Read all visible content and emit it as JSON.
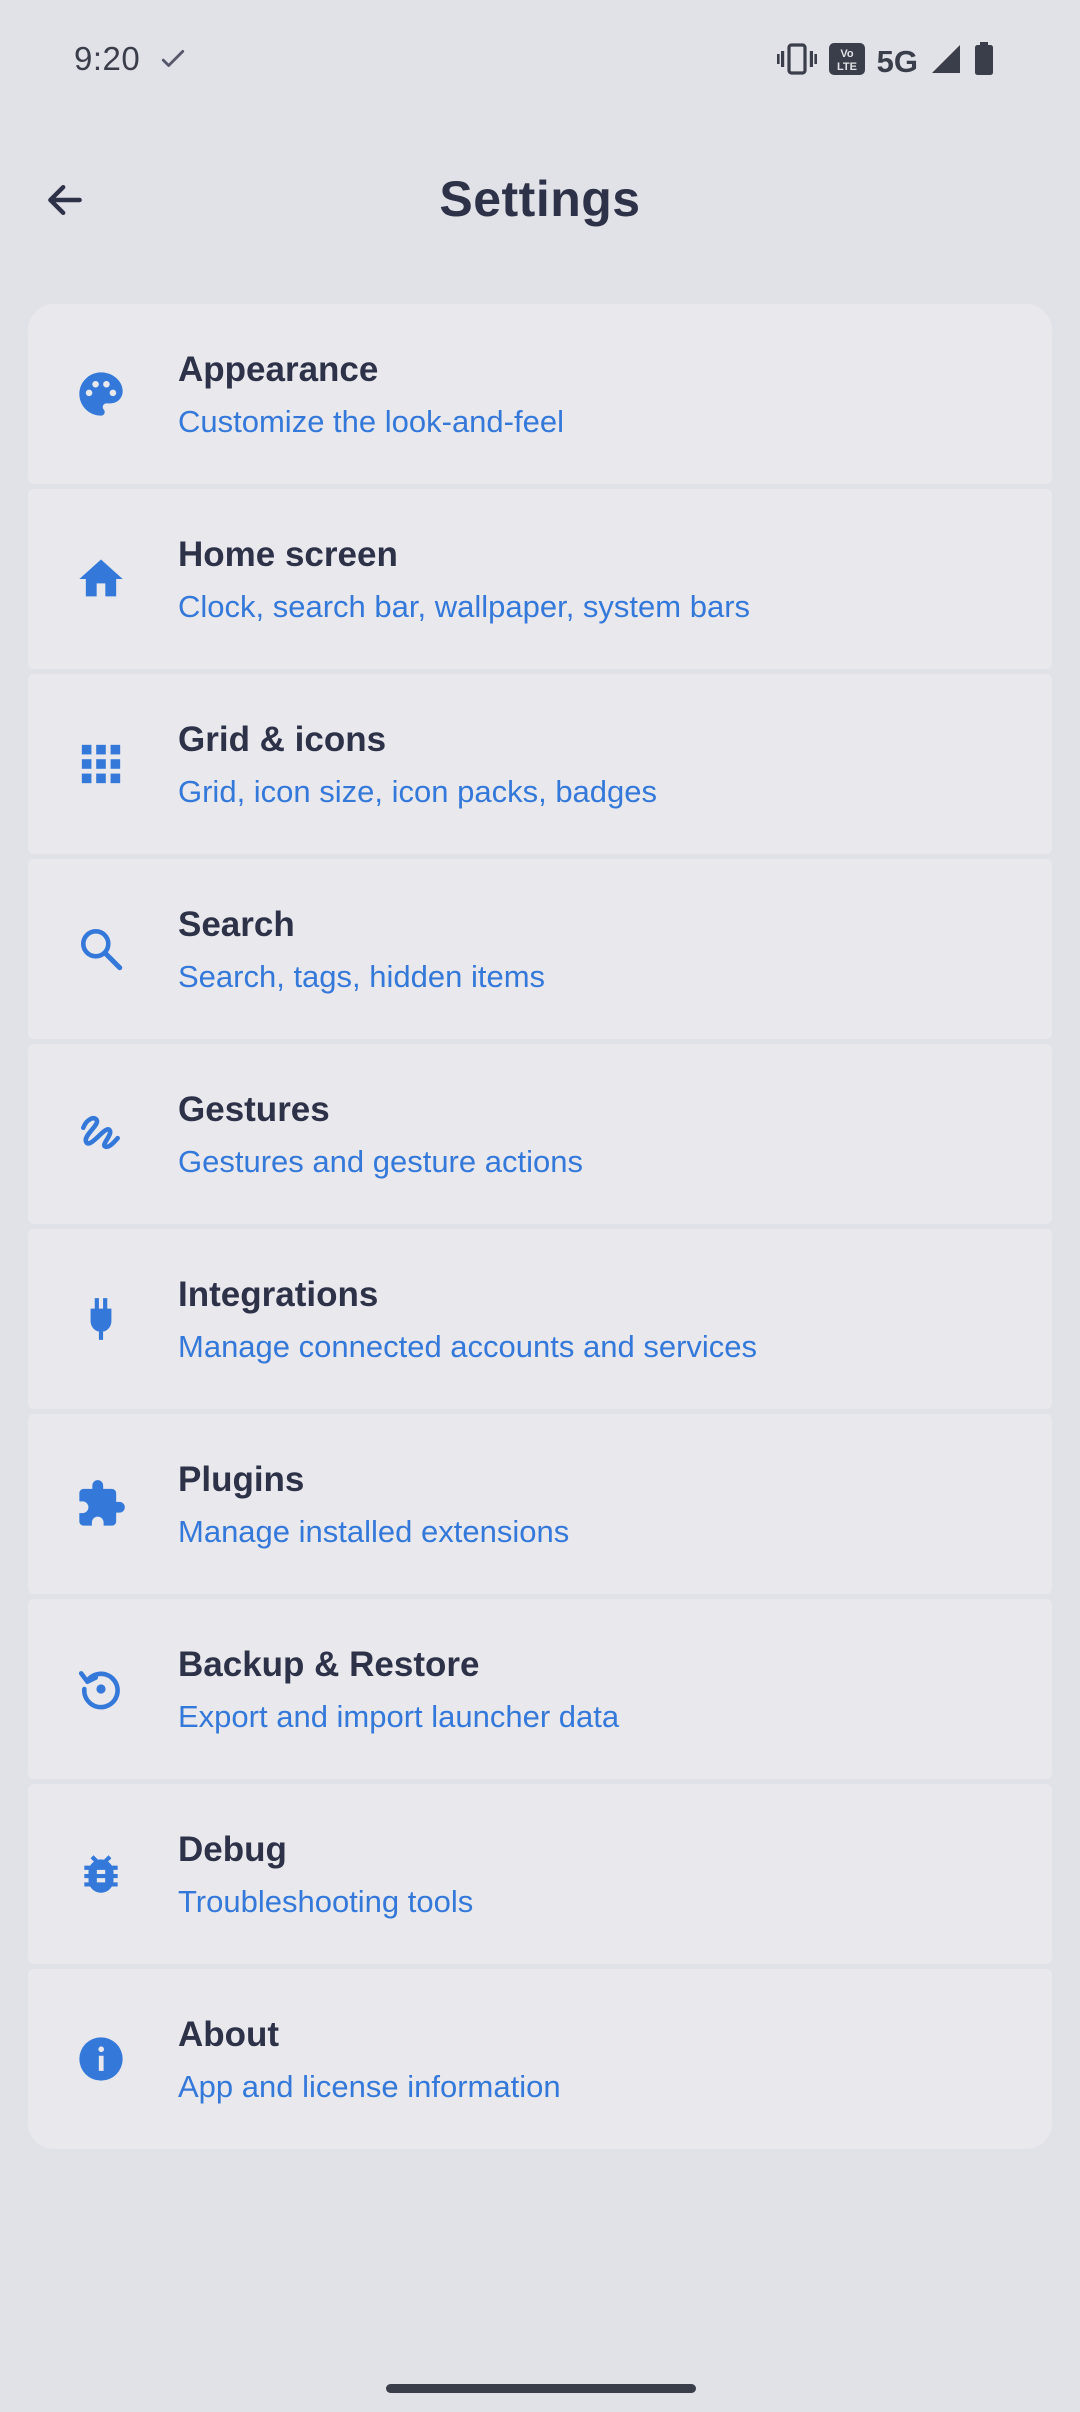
{
  "status_bar": {
    "time": "9:20",
    "network": "5G",
    "icons": [
      "check-icon",
      "vibrate-icon",
      "volte-icon",
      "signal-icon",
      "battery-icon"
    ]
  },
  "header": {
    "title": "Settings",
    "back_icon": "arrow-back-icon"
  },
  "colors": {
    "accent": "#3479d9",
    "background": "#e1e2e7",
    "card": "#e8e8ed",
    "text": "#2e3248"
  },
  "settings": [
    {
      "title": "Appearance",
      "subtitle": "Customize the look-and-feel",
      "icon": "palette-icon"
    },
    {
      "title": "Home screen",
      "subtitle": "Clock, search bar, wallpaper, system bars",
      "icon": "home-icon"
    },
    {
      "title": "Grid & icons",
      "subtitle": "Grid, icon size, icon packs, badges",
      "icon": "grid-icon"
    },
    {
      "title": "Search",
      "subtitle": "Search, tags, hidden items",
      "icon": "search-icon"
    },
    {
      "title": "Gestures",
      "subtitle": "Gestures and gesture actions",
      "icon": "gesture-icon"
    },
    {
      "title": "Integrations",
      "subtitle": "Manage connected accounts and services",
      "icon": "plug-icon"
    },
    {
      "title": "Plugins",
      "subtitle": "Manage installed extensions",
      "icon": "puzzle-icon"
    },
    {
      "title": "Backup & Restore",
      "subtitle": "Export and import launcher data",
      "icon": "restore-icon"
    },
    {
      "title": "Debug",
      "subtitle": "Troubleshooting tools",
      "icon": "bug-icon"
    },
    {
      "title": "About",
      "subtitle": "App and license information",
      "icon": "info-icon"
    }
  ]
}
